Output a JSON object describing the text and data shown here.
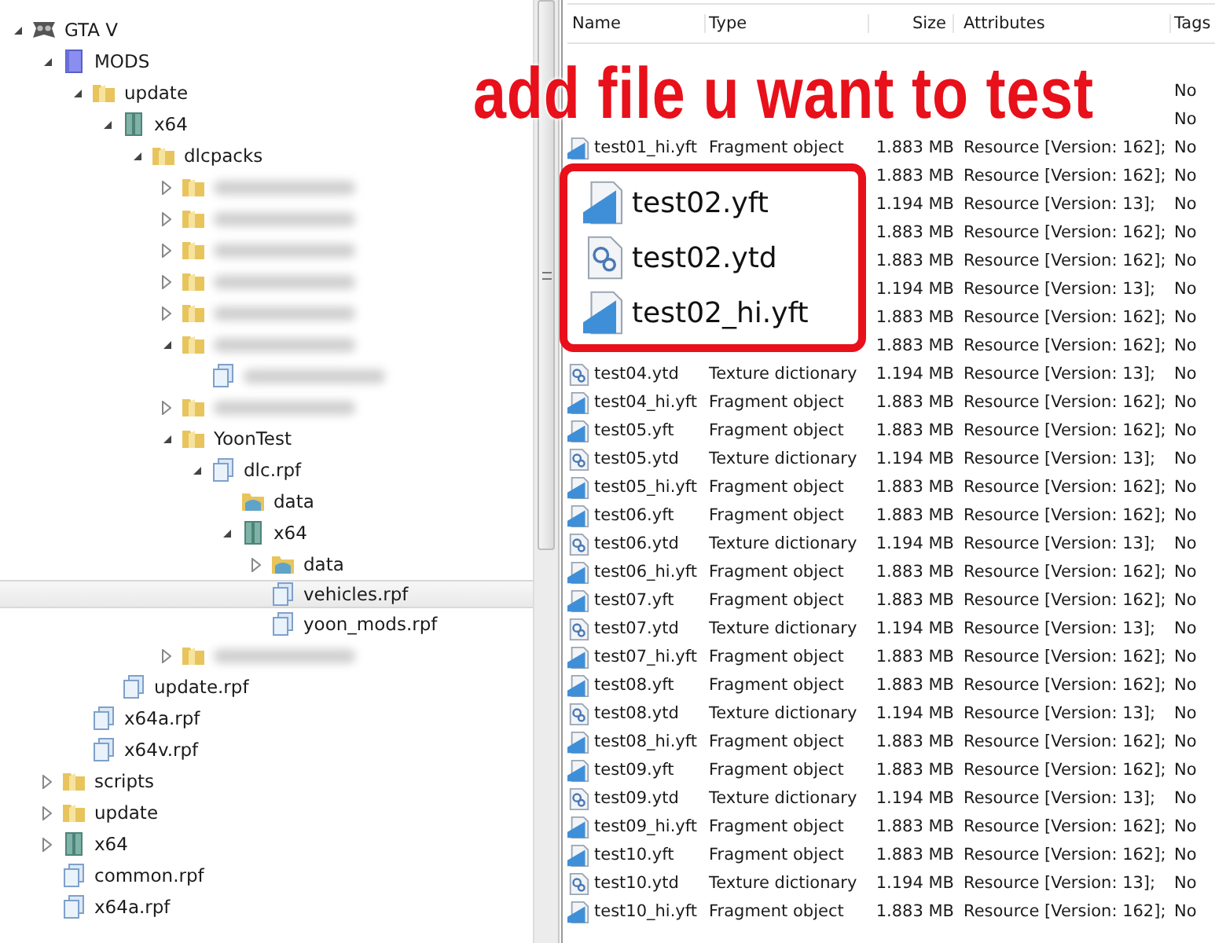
{
  "tree": [
    {
      "label": "GTA V",
      "kind": "game",
      "expanded": true,
      "selected": false,
      "children": [
        {
          "label": "MODS",
          "kind": "mods",
          "expanded": true,
          "selected": false,
          "children": [
            {
              "label": "update",
              "kind": "folder",
              "expanded": true,
              "selected": false,
              "children": [
                {
                  "label": "x64",
                  "kind": "archive",
                  "expanded": true,
                  "selected": false,
                  "children": [
                    {
                      "label": "dlcpacks",
                      "kind": "folder",
                      "expanded": true,
                      "selected": false,
                      "children": [
                        {
                          "blurred": true,
                          "kind": "folder",
                          "expanded": false,
                          "selected": false
                        },
                        {
                          "blurred": true,
                          "kind": "folder",
                          "expanded": false,
                          "selected": false
                        },
                        {
                          "blurred": true,
                          "kind": "folder",
                          "expanded": false,
                          "selected": false
                        },
                        {
                          "blurred": true,
                          "kind": "folder",
                          "expanded": false,
                          "selected": false
                        },
                        {
                          "blurred": true,
                          "kind": "folder",
                          "expanded": false,
                          "selected": false
                        },
                        {
                          "blurred": true,
                          "kind": "folder",
                          "expanded": true,
                          "selected": false,
                          "children": [
                            {
                              "blurred": true,
                              "kind": "rpf",
                              "selected": false
                            }
                          ]
                        },
                        {
                          "blurred": true,
                          "kind": "folder",
                          "expanded": false,
                          "selected": false
                        },
                        {
                          "label": "YoonTest",
                          "kind": "folder",
                          "expanded": true,
                          "selected": false,
                          "children": [
                            {
                              "label": "dlc.rpf",
                              "kind": "rpf",
                              "expanded": true,
                              "selected": false,
                              "children": [
                                {
                                  "label": "data",
                                  "kind": "data",
                                  "selected": false
                                },
                                {
                                  "label": "x64",
                                  "kind": "archive",
                                  "expanded": true,
                                  "selected": false,
                                  "children": [
                                    {
                                      "label": "data",
                                      "kind": "data",
                                      "expanded": false,
                                      "selected": false
                                    },
                                    {
                                      "label": "vehicles.rpf",
                                      "kind": "rpf",
                                      "selected": true
                                    },
                                    {
                                      "label": "yoon_mods.rpf",
                                      "kind": "rpf",
                                      "selected": false
                                    }
                                  ]
                                }
                              ]
                            }
                          ]
                        },
                        {
                          "blurred": true,
                          "kind": "folder",
                          "expanded": false,
                          "selected": false
                        }
                      ]
                    }
                  ]
                },
                {
                  "label": "update.rpf",
                  "kind": "rpf",
                  "selected": false
                }
              ]
            },
            {
              "label": "x64a.rpf",
              "kind": "rpf",
              "selected": false
            },
            {
              "label": "x64v.rpf",
              "kind": "rpf",
              "selected": false
            }
          ]
        },
        {
          "label": "scripts",
          "kind": "folder",
          "expanded": false,
          "selected": false
        },
        {
          "label": "update",
          "kind": "folder",
          "expanded": false,
          "selected": false
        },
        {
          "label": "x64",
          "kind": "archive",
          "expanded": false,
          "selected": false
        },
        {
          "label": "common.rpf",
          "kind": "rpf",
          "selected": false
        },
        {
          "label": "x64a.rpf",
          "kind": "rpf",
          "selected": false
        }
      ]
    }
  ],
  "table": {
    "columns": [
      "Name",
      "Type",
      "Size",
      "Attributes",
      "Tags"
    ],
    "rows": [
      {
        "tags": "No"
      },
      {
        "tags": "No"
      },
      {
        "kind": "yft",
        "name": "test01_hi.yft",
        "type": "Fragment object",
        "size": "1.883 MB",
        "attributes": "Resource [Version: 162];",
        "tags": "No"
      },
      {
        "size": "1.883 MB",
        "attributes": "Resource [Version: 162];",
        "tags": "No"
      },
      {
        "size": "1.194 MB",
        "attributes": "Resource [Version: 13];",
        "tags": "No"
      },
      {
        "size": "1.883 MB",
        "attributes": "Resource [Version: 162];",
        "tags": "No"
      },
      {
        "size": "1.883 MB",
        "attributes": "Resource [Version: 162];",
        "tags": "No"
      },
      {
        "size": "1.194 MB",
        "attributes": "Resource [Version: 13];",
        "tags": "No"
      },
      {
        "size": "1.883 MB",
        "attributes": "Resource [Version: 162];",
        "tags": "No"
      },
      {
        "size": "1.883 MB",
        "attributes": "Resource [Version: 162];",
        "tags": "No"
      },
      {
        "kind": "ytd",
        "name": "test04.ytd",
        "type": "Texture dictionary",
        "size": "1.194 MB",
        "attributes": "Resource [Version: 13];",
        "tags": "No"
      },
      {
        "kind": "yft",
        "name": "test04_hi.yft",
        "type": "Fragment object",
        "size": "1.883 MB",
        "attributes": "Resource [Version: 162];",
        "tags": "No"
      },
      {
        "kind": "yft",
        "name": "test05.yft",
        "type": "Fragment object",
        "size": "1.883 MB",
        "attributes": "Resource [Version: 162];",
        "tags": "No"
      },
      {
        "kind": "ytd",
        "name": "test05.ytd",
        "type": "Texture dictionary",
        "size": "1.194 MB",
        "attributes": "Resource [Version: 13];",
        "tags": "No"
      },
      {
        "kind": "yft",
        "name": "test05_hi.yft",
        "type": "Fragment object",
        "size": "1.883 MB",
        "attributes": "Resource [Version: 162];",
        "tags": "No"
      },
      {
        "kind": "yft",
        "name": "test06.yft",
        "type": "Fragment object",
        "size": "1.883 MB",
        "attributes": "Resource [Version: 162];",
        "tags": "No"
      },
      {
        "kind": "ytd",
        "name": "test06.ytd",
        "type": "Texture dictionary",
        "size": "1.194 MB",
        "attributes": "Resource [Version: 13];",
        "tags": "No"
      },
      {
        "kind": "yft",
        "name": "test06_hi.yft",
        "type": "Fragment object",
        "size": "1.883 MB",
        "attributes": "Resource [Version: 162];",
        "tags": "No"
      },
      {
        "kind": "yft",
        "name": "test07.yft",
        "type": "Fragment object",
        "size": "1.883 MB",
        "attributes": "Resource [Version: 162];",
        "tags": "No"
      },
      {
        "kind": "ytd",
        "name": "test07.ytd",
        "type": "Texture dictionary",
        "size": "1.194 MB",
        "attributes": "Resource [Version: 13];",
        "tags": "No"
      },
      {
        "kind": "yft",
        "name": "test07_hi.yft",
        "type": "Fragment object",
        "size": "1.883 MB",
        "attributes": "Resource [Version: 162];",
        "tags": "No"
      },
      {
        "kind": "yft",
        "name": "test08.yft",
        "type": "Fragment object",
        "size": "1.883 MB",
        "attributes": "Resource [Version: 162];",
        "tags": "No"
      },
      {
        "kind": "ytd",
        "name": "test08.ytd",
        "type": "Texture dictionary",
        "size": "1.194 MB",
        "attributes": "Resource [Version: 13];",
        "tags": "No"
      },
      {
        "kind": "yft",
        "name": "test08_hi.yft",
        "type": "Fragment object",
        "size": "1.883 MB",
        "attributes": "Resource [Version: 162];",
        "tags": "No"
      },
      {
        "kind": "yft",
        "name": "test09.yft",
        "type": "Fragment object",
        "size": "1.883 MB",
        "attributes": "Resource [Version: 162];",
        "tags": "No"
      },
      {
        "kind": "ytd",
        "name": "test09.ytd",
        "type": "Texture dictionary",
        "size": "1.194 MB",
        "attributes": "Resource [Version: 13];",
        "tags": "No"
      },
      {
        "kind": "yft",
        "name": "test09_hi.yft",
        "type": "Fragment object",
        "size": "1.883 MB",
        "attributes": "Resource [Version: 162];",
        "tags": "No"
      },
      {
        "kind": "yft",
        "name": "test10.yft",
        "type": "Fragment object",
        "size": "1.883 MB",
        "attributes": "Resource [Version: 162];",
        "tags": "No"
      },
      {
        "kind": "ytd",
        "name": "test10.ytd",
        "type": "Texture dictionary",
        "size": "1.194 MB",
        "attributes": "Resource [Version: 13];",
        "tags": "No"
      },
      {
        "kind": "yft",
        "name": "test10_hi.yft",
        "type": "Fragment object",
        "size": "1.883 MB",
        "attributes": "Resource [Version: 162];",
        "tags": "No"
      }
    ]
  },
  "annotation": {
    "caption": "add file u want to test",
    "files": [
      {
        "kind": "yft",
        "name": "test02.yft"
      },
      {
        "kind": "ytd",
        "name": "test02.ytd"
      },
      {
        "kind": "yft",
        "name": "test02_hi.yft"
      }
    ]
  }
}
